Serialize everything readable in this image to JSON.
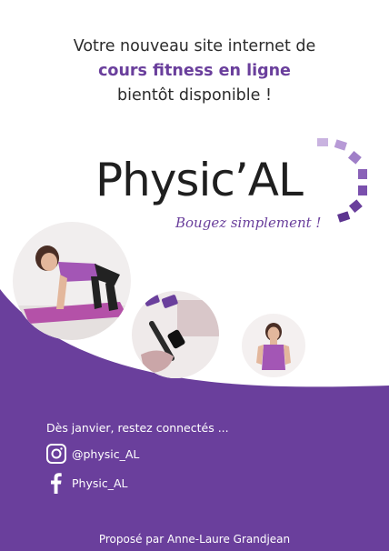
{
  "headline": {
    "line1": "Votre nouveau site internet de",
    "line2": "cours fitness en ligne",
    "line3": "bientôt disponible !"
  },
  "logo": {
    "brand": "Physic’AL",
    "tagline": "Bougez simplement !"
  },
  "footer": {
    "intro": "Dès janvier, restez connectés ...",
    "instagram": "@physic_AL",
    "facebook": "Physic_AL",
    "credit": "Proposé par Anne-Laure Grandjean"
  },
  "colors": {
    "brand_purple": "#6a3f9c",
    "light_purple": "#c9b3e0",
    "text_dark": "#2b2b2b"
  }
}
